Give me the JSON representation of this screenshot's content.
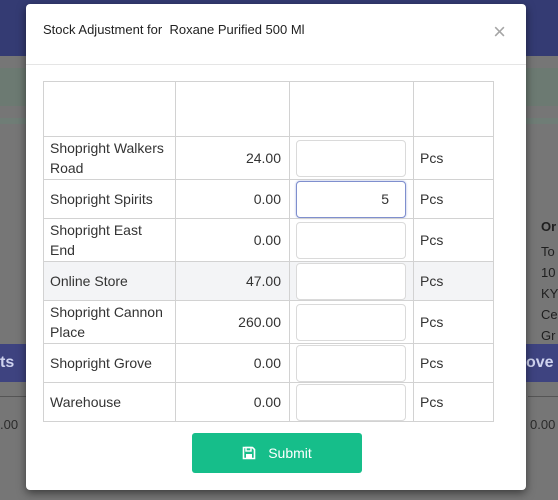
{
  "modal": {
    "title": "Stock Adjustment for  Roxane Purified 500 Ml",
    "close_glyph": "×",
    "submit_label": "Submit",
    "submit_icon": "save-icon"
  },
  "table": {
    "headers": [
      "",
      "",
      "",
      ""
    ],
    "rows": [
      {
        "location": "Shopright Walkers Road",
        "qty": "24.00",
        "input": "",
        "unit": "Pcs"
      },
      {
        "location": "Shopright Spirits",
        "qty": "0.00",
        "input": "5",
        "unit": "Pcs"
      },
      {
        "location": "Shopright East End",
        "qty": "0.00",
        "input": "",
        "unit": "Pcs"
      },
      {
        "location": "Online Store",
        "qty": "47.00",
        "input": "",
        "unit": "Pcs"
      },
      {
        "location": "Shopright Cannon Place",
        "qty": "260.00",
        "input": "",
        "unit": "Pcs"
      },
      {
        "location": "Shopright Grove",
        "qty": "0.00",
        "input": "",
        "unit": "Pcs"
      },
      {
        "location": "Warehouse",
        "qty": "0.00",
        "input": "",
        "unit": "Pcs"
      }
    ]
  },
  "background": {
    "left_tab": "ts",
    "right_tab": "ove",
    "left_num": ".00",
    "right_num": "0.00",
    "side_lines": [
      "Or",
      "To",
      "10",
      "KY",
      "Ce",
      "Gr"
    ]
  },
  "colors": {
    "submit": "#16be8a",
    "backdrop_header": "#343b73"
  }
}
